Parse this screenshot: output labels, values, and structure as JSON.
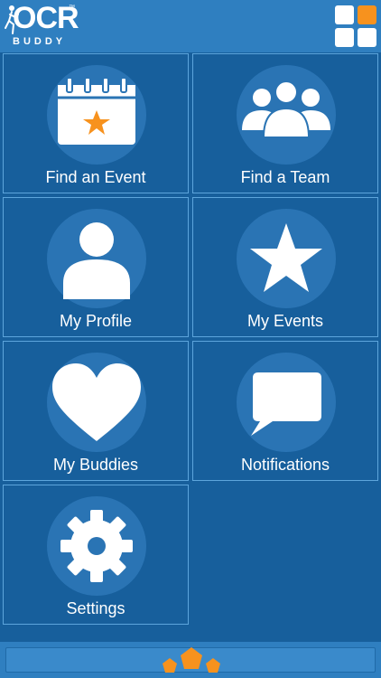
{
  "app": {
    "logo_text": "OCR",
    "logo_subtext": "BUDDY",
    "logo_tm": "™"
  },
  "colors": {
    "header": "#2f7fc0",
    "tile": "#175f9c",
    "icon_circle": "#2a74b4",
    "accent": "#f7921e",
    "white": "#ffffff"
  },
  "tiles": [
    {
      "label": "Find an Event",
      "icon": "calendar-star-icon"
    },
    {
      "label": "Find a Team",
      "icon": "group-icon"
    },
    {
      "label": "My Profile",
      "icon": "person-icon"
    },
    {
      "label": "My Events",
      "icon": "star-icon"
    },
    {
      "label": "My Buddies",
      "icon": "heart-icon"
    },
    {
      "label": "Notifications",
      "icon": "speech-bubble-icon"
    },
    {
      "label": "Settings",
      "icon": "gear-icon"
    }
  ],
  "header": {
    "menu_icon": "grid-menu-icon"
  },
  "footer": {
    "icon": "pentagons-icon"
  }
}
